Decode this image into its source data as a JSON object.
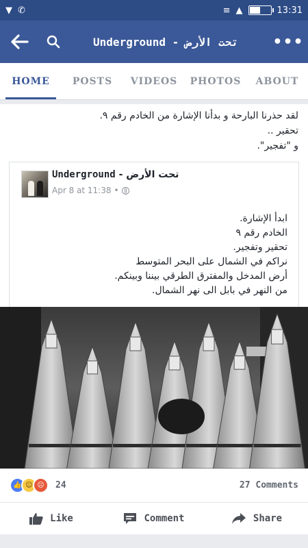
{
  "status_bar": {
    "time": "13:31",
    "left_icons": [
      "shield-icon",
      "whatsapp-icon"
    ],
    "right_icons": [
      "vibrate-icon",
      "signal-icon",
      "battery-icon"
    ],
    "battery_level": 0.55
  },
  "app_bar": {
    "title": "Underground - تحت الأرض",
    "back_icon": "back-arrow-icon",
    "search_icon": "search-icon",
    "more_label": "•••"
  },
  "tabs": [
    {
      "label": "HOME",
      "active": true
    },
    {
      "label": "POSTS",
      "active": false
    },
    {
      "label": "VIDEOS",
      "active": false
    },
    {
      "label": "PHOTOS",
      "active": false
    },
    {
      "label": "ABOUT",
      "active": false
    }
  ],
  "post": {
    "text_lines": [
      "لقد حذرنا البارحة و بدأنا الإشارة من الخادم رقم ٩.",
      "تحقير ..",
      "و \"تفجير\"."
    ],
    "shared": {
      "page_name_en": "Underground",
      "page_name_ar": " - تحت الأرض",
      "timestamp": "Apr 8 at 11:38",
      "privacy_icon": "globe-icon",
      "text_lines": [
        "ابدأ الإشارة.",
        "الخادم رقم ٩",
        "تحقير وتفجير.",
        "نراكم في الشمال على البحر المتوسط",
        "أرض المدخل والمفترق الطرقي بيننا وبينكم.",
        "من النهر في بابل الى نهر الشمال."
      ]
    },
    "reactions": {
      "icons": [
        "like-reaction-icon",
        "haha-reaction-icon",
        "angry-reaction-icon"
      ],
      "count": "24",
      "comments": "27 Comments"
    },
    "actions": [
      {
        "label": "Like",
        "icon": "thumbs-up-icon"
      },
      {
        "label": "Comment",
        "icon": "comment-icon"
      },
      {
        "label": "Share",
        "icon": "share-arrow-icon"
      }
    ]
  },
  "colors": {
    "status_bar": "#2d4c86",
    "app_bar": "#3b5998",
    "active_tab": "#3b5998",
    "inactive_tab": "#8d949e",
    "background": "#e9ebee"
  }
}
